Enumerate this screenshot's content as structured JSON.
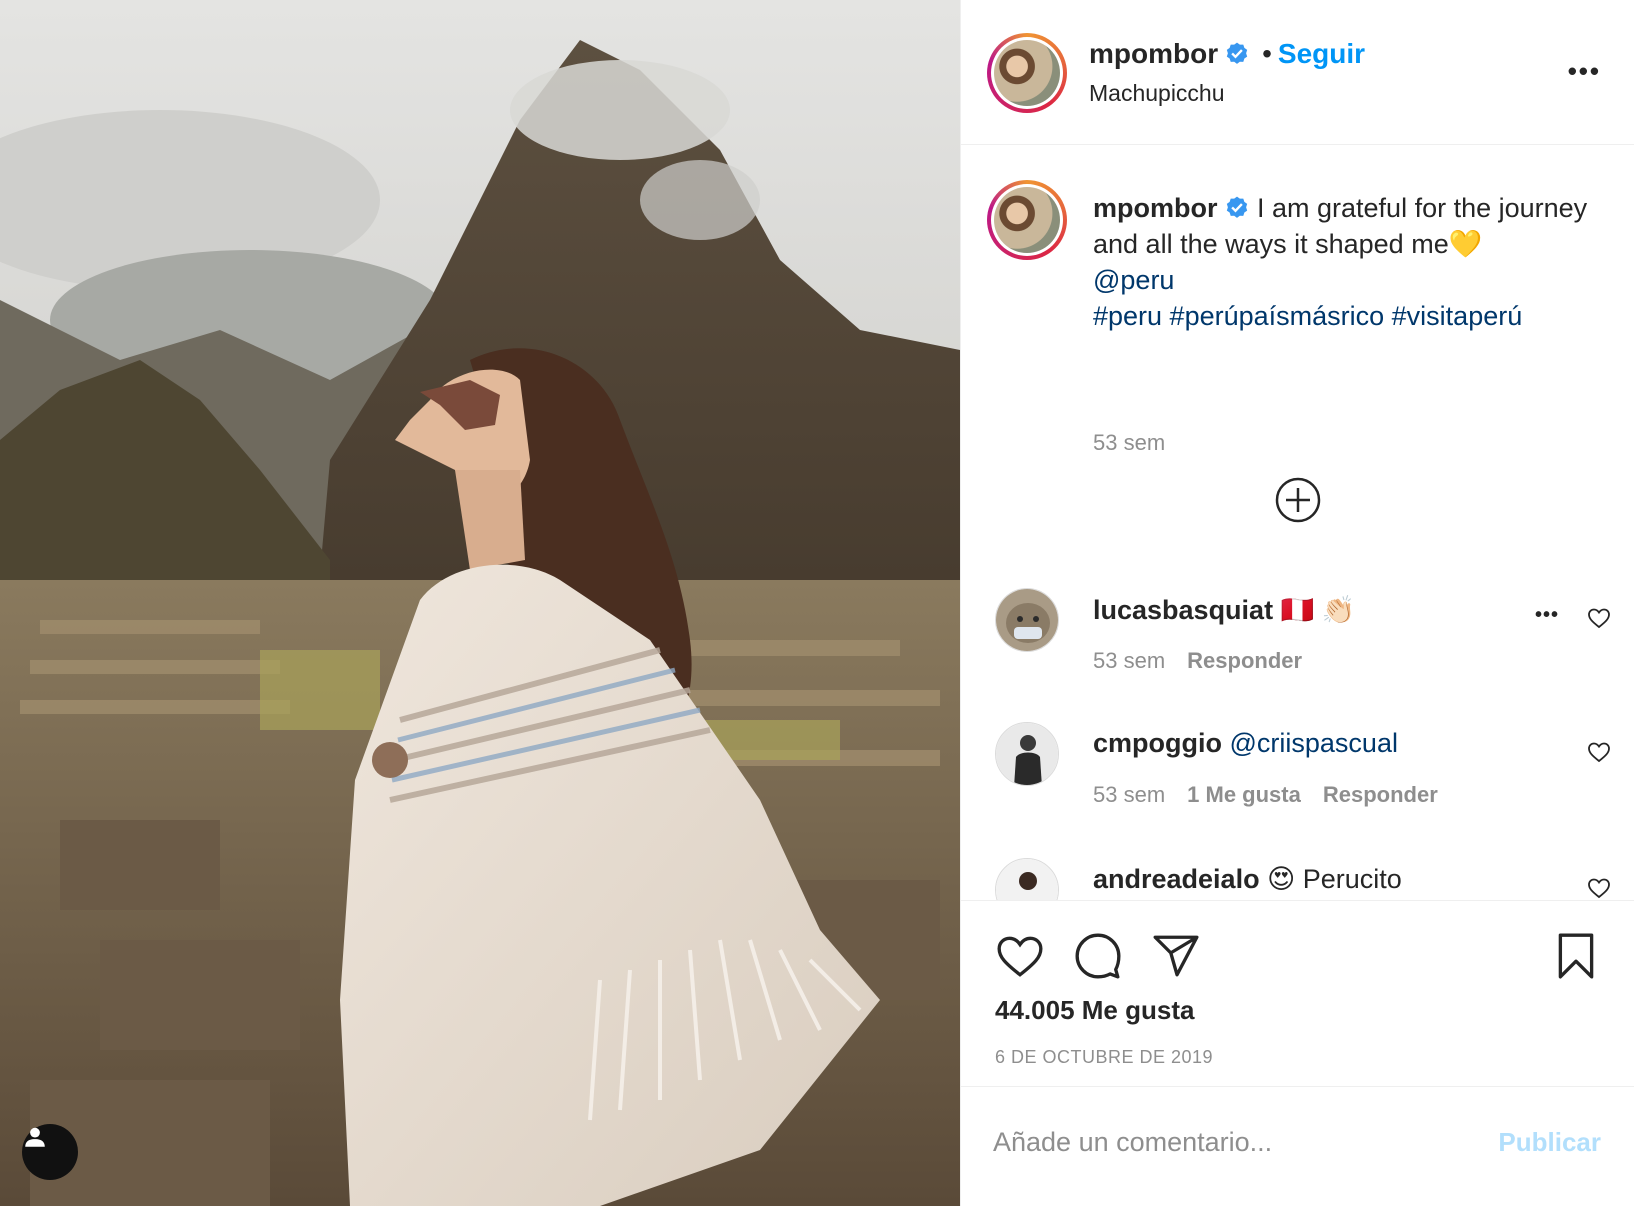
{
  "post": {
    "author": "mpombor",
    "follow_label": "Seguir",
    "separator": "•",
    "location": "Machupicchu",
    "more_label": "•••"
  },
  "caption": {
    "author": "mpombor",
    "line1": " I am grateful for the journey",
    "line2": "and all the ways it shaped me💛",
    "mention": "@peru",
    "hashtags": "#peru #perúpaísmásrico #visitaperú",
    "time": "53 sem"
  },
  "comments": [
    {
      "username": "lucasbasquiat",
      "text": " 🇵🇪 👏🏻",
      "time": "53 sem",
      "likes": "",
      "reply_label": "Responder",
      "more_label": "•••"
    },
    {
      "username": "cmpoggio",
      "text": " @criispascual",
      "time": "53 sem",
      "likes": "1 Me gusta",
      "reply_label": "Responder"
    },
    {
      "username": "andreadeialo",
      "text": " 😍 Perucito"
    }
  ],
  "actions": {
    "likes_count": "44.005 Me gusta",
    "date": "6 DE OCTUBRE DE 2019"
  },
  "composer": {
    "placeholder": "Añade un comentario...",
    "publish_label": "Publicar"
  },
  "colors": {
    "accent": "#0095f6",
    "link": "#00376b",
    "muted": "#8e8e8e",
    "publish_disabled": "#b2dffc"
  },
  "icons": [
    "verified-badge-icon",
    "more-icon",
    "load-more-comments-icon",
    "heart-icon",
    "comment-icon",
    "share-icon",
    "save-bookmark-icon",
    "user-tag-icon"
  ]
}
